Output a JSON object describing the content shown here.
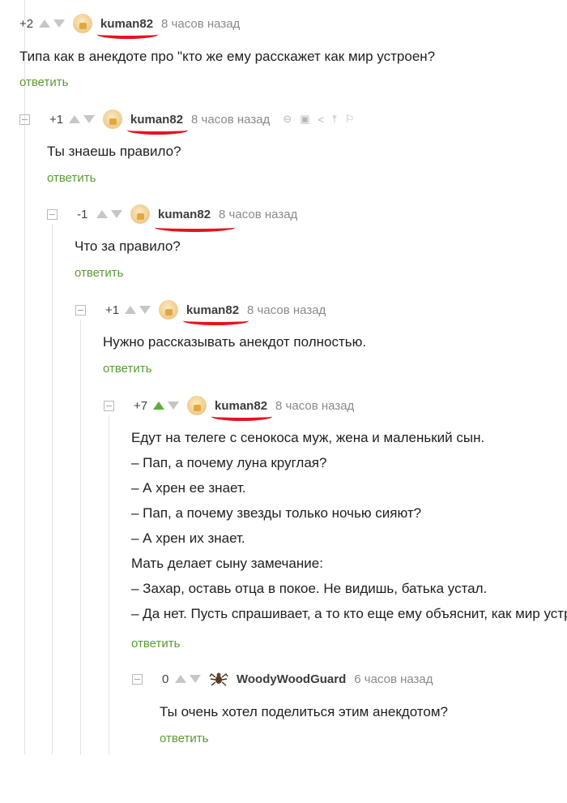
{
  "reply_label": "ответить",
  "comments": [
    {
      "rating": "+2",
      "user": "kuman82",
      "time": "8 часов назад",
      "body": [
        "Типа как в анекдоте про \"кто же ему расскажет как мир устроен?"
      ]
    },
    {
      "rating": "+1",
      "user": "kuman82",
      "time": "8 часов назад",
      "body": [
        "Ты знаешь правило?"
      ]
    },
    {
      "rating": "-1",
      "user": "kuman82",
      "time": "8 часов назад",
      "body": [
        "Что за правило?"
      ]
    },
    {
      "rating": "+1",
      "user": "kuman82",
      "time": "8 часов назад",
      "body": [
        "Нужно рассказывать анекдот полностью."
      ]
    },
    {
      "rating": "+7",
      "user": "kuman82",
      "time": "8 часов назад",
      "body": [
        "Едут на телеге с сенокоса муж, жена и маленький сын.",
        "– Пап, а почему луна круглая?",
        "– А хрен ее знает.",
        "– Пап, а почему звезды только ночью сияют?",
        "– А хрен их знает.",
        "Мать делает сыну замечание:",
        "– Захар, оставь отца в покое. Не видишь, батька устал.",
        "– Да нет. Пусть спрашивает, а то кто еще ему объяснит, как мир устроен"
      ]
    },
    {
      "rating": "0",
      "user": "WoodyWoodGuard",
      "time": "6 часов назад",
      "body": [
        "Ты очень хотел поделиться этим анекдотом?"
      ]
    }
  ],
  "icons": [
    "link-icon",
    "save-icon",
    "share-icon",
    "upload-icon",
    "flag-icon"
  ],
  "colors": {
    "reply_green": "#5b9b33",
    "upvote_active": "#5faa3b",
    "highlight_red": "#e4141e"
  }
}
